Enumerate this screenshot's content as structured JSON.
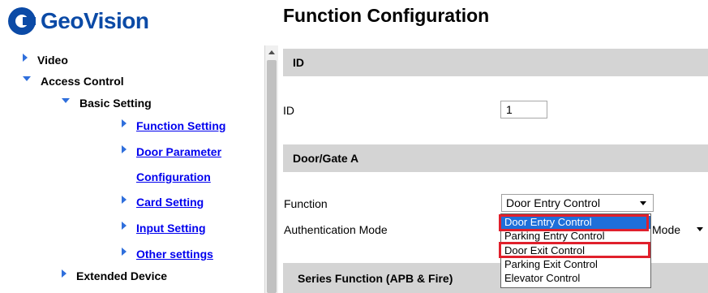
{
  "logo": {
    "text": "GeoVision",
    "brand_color": "#0b4aa6"
  },
  "nav": {
    "items": [
      {
        "label": "Video",
        "level": 1,
        "icon": "triangle-right-icon"
      },
      {
        "label": "Access Control",
        "level": 1,
        "icon": "triangle-down-icon"
      },
      {
        "label": "Basic Setting",
        "level": 2,
        "icon": "triangle-down-icon"
      },
      {
        "label": "Function Setting",
        "level": 3,
        "icon": "triangle-right-icon",
        "link": true
      },
      {
        "label": "Door Parameter",
        "level": 3,
        "icon": "triangle-right-icon",
        "link": true
      },
      {
        "label": "Configuration",
        "level": 3,
        "link": true
      },
      {
        "label": "Card Setting",
        "level": 3,
        "icon": "triangle-right-icon",
        "link": true
      },
      {
        "label": "Input Setting",
        "level": 3,
        "icon": "triangle-right-icon",
        "link": true
      },
      {
        "label": "Other settings",
        "level": 3,
        "icon": "triangle-right-icon",
        "link": true
      },
      {
        "label": "Extended Device",
        "level": 2,
        "icon": "triangle-right-icon"
      }
    ]
  },
  "main": {
    "title": "Function Configuration",
    "sections": {
      "id": {
        "header": "ID",
        "label": "ID",
        "value": "1"
      },
      "door": {
        "header": "Door/Gate A",
        "function_label": "Function",
        "function_value": "Door Entry Control",
        "auth_label": "Authentication Mode",
        "auth_value_partial": "Mode"
      },
      "series": {
        "header": "Series Function (APB & Fire)"
      }
    },
    "dropdown_options": [
      "Door Entry Control",
      "Parking Entry Control",
      "Door Exit Control",
      "Parking Exit Control",
      "Elevator Control"
    ],
    "dropdown_selected_index": 0,
    "highlight_color": "#e0202c"
  }
}
